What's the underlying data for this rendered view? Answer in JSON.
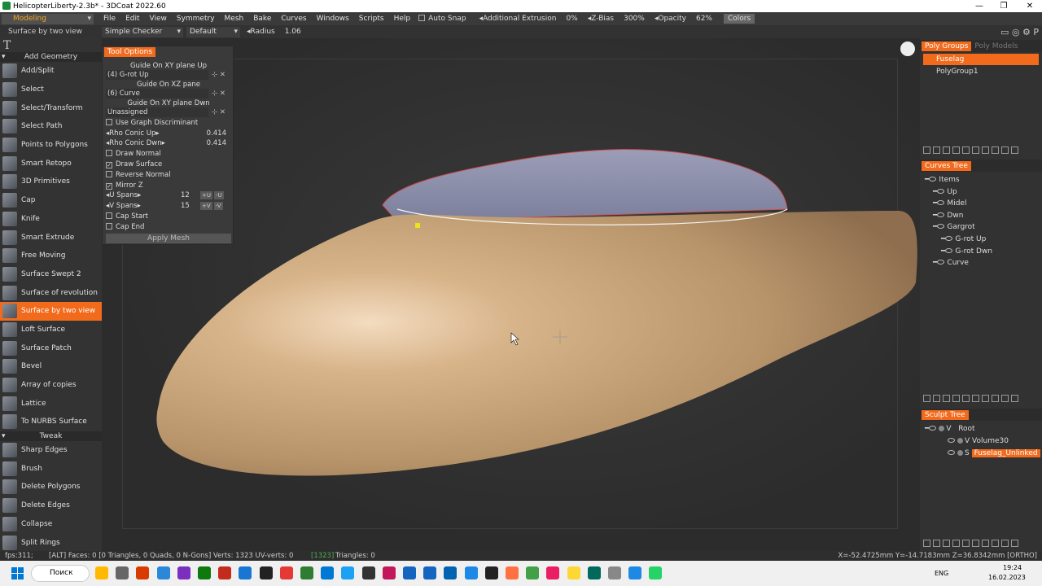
{
  "window": {
    "title": "HelicopterLiberty-2.3b* - 3DCoat 2022.60",
    "controls": [
      "—",
      "❐",
      "✕"
    ]
  },
  "menubar": {
    "room": "Modeling",
    "items": [
      "File",
      "Edit",
      "View",
      "Symmetry",
      "Mesh",
      "Bake",
      "Curves",
      "Windows",
      "Scripts",
      "Help"
    ],
    "auto_snap": "Auto Snap",
    "additional_extrusion_label": "Additional Extrusion",
    "additional_extrusion_value": "0%",
    "zbias_label": "Z-Bias",
    "zbias_value": "300%",
    "opacity_label": "Opacity",
    "opacity_value": "62%",
    "colors": "Colors"
  },
  "toolbar2": {
    "current_tool": "Surface by two view",
    "material": "Simple Checker",
    "preset": "Default",
    "radius_label": "Radius",
    "radius_value": "1.06"
  },
  "leftpanel": {
    "add_geometry": "Add Geometry",
    "tools": [
      "Add/Split",
      "Select",
      "Select/Transform",
      "Select Path",
      "Points to Polygons",
      "Smart Retopo",
      "3D Primitives",
      "Cap",
      "Knife",
      "Smart Extrude",
      "Free Moving",
      "Surface Swept 2",
      "Surface of revolution",
      "Surface by two view",
      "Loft Surface",
      "Surface Patch",
      "Bevel",
      "Array of copies",
      "Lattice",
      "To NURBS Surface"
    ],
    "tweak": "Tweak",
    "tweak_tools": [
      "Sharp Edges",
      "Brush",
      "Delete Polygons",
      "Delete Edges",
      "Collapse",
      "Split Rings"
    ]
  },
  "tool_options": {
    "title": "Tool Options",
    "guide1_label": "Guide On XY plane Up",
    "guide1_value": "(4) G-rot Up",
    "guide2_label": "Guide On XZ pane",
    "guide2_value": "(6) Curve",
    "guide3_label": "Guide On XY plane Dwn",
    "guide3_value": "Unassigned",
    "use_graph": "Use Graph Discriminant",
    "rho_up_label": "Rho Conic Up",
    "rho_up_value": "0.414",
    "rho_dwn_label": "Rho Conic Dwn",
    "rho_dwn_value": "0.414",
    "draw_normal": "Draw Normal",
    "draw_surface": "Draw Surface",
    "reverse_normal": "Reverse Normal",
    "mirror_z": "Mirror Z",
    "u_spans_label": "U Spans",
    "u_spans_value": "12",
    "v_spans_label": "V Spans",
    "v_spans_value": "15",
    "plus_u": "+U",
    "minus_u": "-U",
    "plus_v": "+V",
    "minus_v": "-V",
    "cap_start": "Cap Start",
    "cap_end": "Cap End",
    "apply": "Apply Mesh"
  },
  "rightpanel": {
    "polygroups_tab": "Poly Groups",
    "polymodels_tab": "Poly Models",
    "polygroups": [
      "Fuselag",
      "PolyGroup1"
    ],
    "curves_tree_tab": "Curves Tree",
    "curves": [
      {
        "label": "Items",
        "indent": 0
      },
      {
        "label": "Up",
        "indent": 1
      },
      {
        "label": "Midel",
        "indent": 1
      },
      {
        "label": "Dwn",
        "indent": 1
      },
      {
        "label": "Gargrot",
        "indent": 1
      },
      {
        "label": "G-rot Up",
        "indent": 2
      },
      {
        "label": "G-rot Dwn",
        "indent": 2
      },
      {
        "label": "Curve",
        "indent": 1
      }
    ],
    "sculpt_tree_tab": "Sculpt Tree",
    "sculpt_root": "Root",
    "sculpt_root_prefix": "V",
    "sculpt_volume": "Volume30",
    "sculpt_volume_prefix": "V",
    "sculpt_selected": "Fuselag_Unlinked",
    "sculpt_selected_prefix": "S"
  },
  "statusbar": {
    "fps": "fps:311;",
    "faces": "[ALT] Faces: 0  [0 Triangles, 0 Quads, 0 N-Gons] Verts: 1323  UV-verts: 0",
    "uv_highlight": "[1323]",
    "triangles": "Triangles: 0",
    "coords": "X=-52.4725mm  Y=-14.7183mm  Z=36.8342mm  [ORTHO]"
  },
  "taskbar": {
    "search": "Поиск",
    "lang": "ENG",
    "time": "19:24",
    "date": "16.02.2023"
  },
  "colors": {
    "accent": "#f26b1d",
    "fuselage": "#c9a77d",
    "canopy": "#8c8ea8"
  }
}
